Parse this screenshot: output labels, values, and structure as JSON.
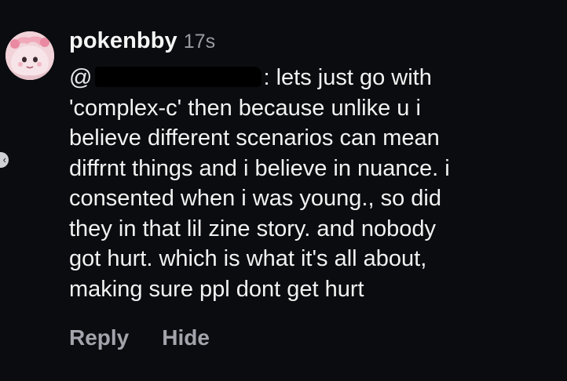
{
  "comment": {
    "username": "pokenbby",
    "timestamp": "17s",
    "mention_prefix": "@",
    "mention_suffix": ":",
    "body_lines": [
      "lets just go with",
      "'complex-c' then because unlike u i",
      "believe different scenarios can mean",
      "diffrnt things and i believe in nuance. i",
      "consented when i was young., so did",
      "they in that lil zine story. and nobody",
      "got hurt. which is what it's all about,",
      "making sure ppl dont get hurt"
    ]
  },
  "actions": {
    "reply_label": "Reply",
    "hide_label": "Hide"
  },
  "icons": {
    "avatar": "avatar-image",
    "edge": "chevron-left-icon"
  },
  "colors": {
    "background": "#0b0c10",
    "text": "#f2f2f2",
    "muted": "#9a9ca3"
  }
}
